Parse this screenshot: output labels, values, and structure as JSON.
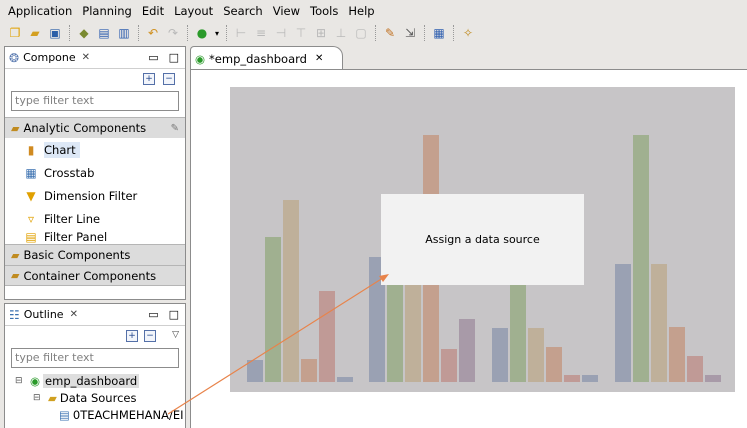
{
  "menu": [
    "Application",
    "Planning",
    "Edit",
    "Layout",
    "Search",
    "View",
    "Tools",
    "Help"
  ],
  "toolbar_icons": [
    "new-icon",
    "open-icon",
    "save-icon",
    "deploy-icon",
    "bookmark-icon",
    "book-icon",
    "undo-icon",
    "redo-icon",
    "run-icon",
    "run-dropdown-icon",
    "align-left-icon",
    "align-center-icon",
    "align-right-icon",
    "align-top-icon",
    "align-middle-icon",
    "align-bottom-icon",
    "fit-icon",
    "pencil-icon",
    "export-icon",
    "table-icon",
    "script-icon"
  ],
  "components_panel": {
    "title": "Compone",
    "filter_placeholder": "type filter text",
    "categories": [
      {
        "label": "Analytic Components",
        "items": [
          {
            "label": "Chart",
            "icon": "bar-chart-icon",
            "selected": true
          },
          {
            "label": "Crosstab",
            "icon": "crosstab-icon"
          },
          {
            "label": "Dimension Filter",
            "icon": "funnel-icon"
          },
          {
            "label": "Filter Line",
            "icon": "funnel-line-icon"
          },
          {
            "label": "Filter Panel",
            "icon": "filter-panel-icon"
          }
        ]
      },
      {
        "label": "Basic Components"
      },
      {
        "label": "Container Components"
      }
    ]
  },
  "outline_panel": {
    "title": "Outline",
    "filter_placeholder": "type filter text",
    "tree": [
      {
        "label": "emp_dashboard",
        "level": 0
      },
      {
        "label": "Data Sources",
        "level": 1
      },
      {
        "label": "0TEACHMEHANA/EI",
        "level": 2
      }
    ]
  },
  "editor": {
    "tab_label": "*emp_dashboard",
    "placeholder": "Assign a data source"
  },
  "colors": {
    "chart_bg": "#c7c5c7",
    "bar_blue": "#9aa1b3",
    "bar_green": "#a0b090",
    "bar_tan": "#bfb09a",
    "bar_rose": "#c09a96",
    "bar_purple": "#a89aa8",
    "arrow": "#e8834a"
  }
}
